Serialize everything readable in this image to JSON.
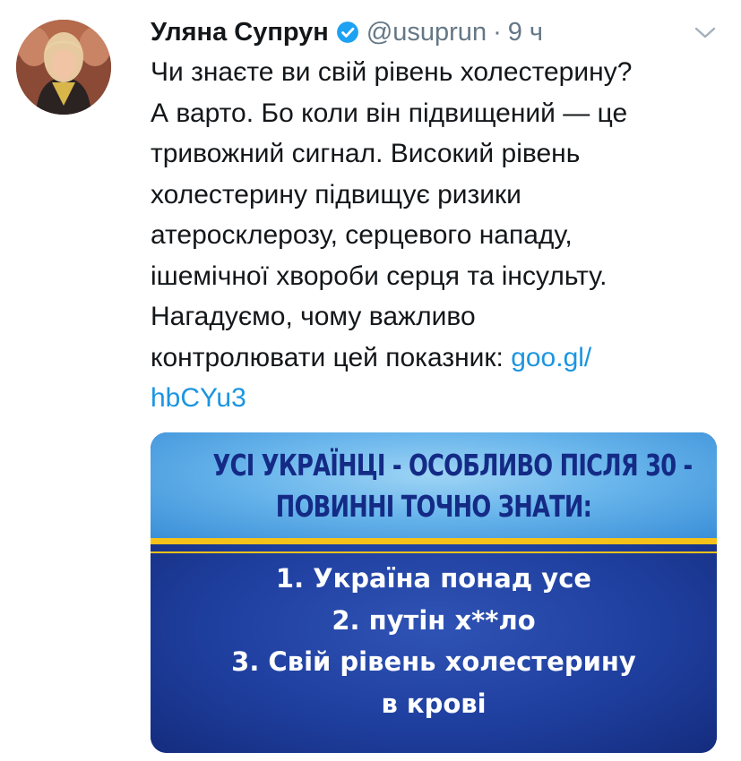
{
  "tweet": {
    "author_name": "Уляна Супрун",
    "handle": "@usuprun",
    "separator": "·",
    "time": "9 ч",
    "verified_icon": "verified-badge-icon",
    "menu_icon": "chevron-down-icon",
    "text_lines": [
      "Чи знаєте ви свій рівень холестерину?",
      "А варто. Бо коли він підвищений — це",
      "тривожний сигнал. Високий рівень",
      "холестерину підвищує ризики",
      "атеросклерозу, серцевого нападу,",
      "ішемічної хвороби серця та інсульту.",
      "Нагадуємо, чому важливо"
    ],
    "last_line_text": "контролювати цей показник: ",
    "link_part1": "goo.gl/",
    "link_part2": "hbCYu3"
  },
  "card": {
    "title_lines": [
      "УСІ УКРАЇНЦІ - ОСОБЛИВО ПІСЛЯ 30 -",
      "ПОВИННІ ТОЧНО ЗНАТИ:"
    ],
    "list_lines": [
      "1. Україна понад усе",
      "2. путін х**ло",
      "3. Свій рівень холестерину",
      "в крові"
    ],
    "colors": {
      "top_bg": "#6ab6ec",
      "title_text": "#142b86",
      "stripe": "#f6c21a",
      "bottom_bg": "#1f3f9f",
      "list_text": "#ffffff"
    }
  },
  "colors": {
    "link": "#1b95e0",
    "muted": "#657786",
    "verified": "#1da1f2"
  }
}
